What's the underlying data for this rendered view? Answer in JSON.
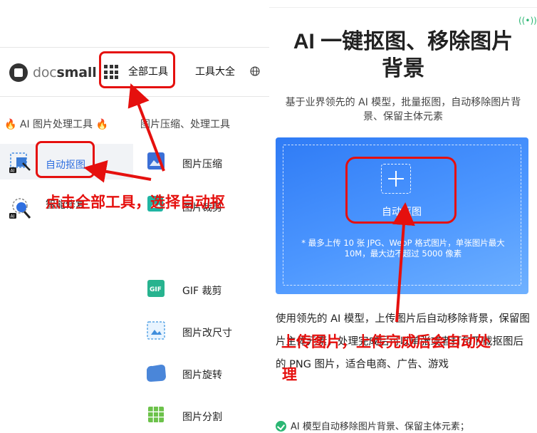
{
  "site": {
    "logo_prefix": "doc",
    "logo_suffix": "small",
    "nav": {
      "all_tools": "全部工具",
      "tools_collection": "工具大全"
    }
  },
  "menu": {
    "category_ai": "🔥 AI 图片处理工具 🔥",
    "category_image": "图片压缩、处理工具",
    "ai_items": [
      {
        "label": "自动抠图",
        "icon": "auto-matting-icon",
        "selected": true
      },
      {
        "label": "智能修复",
        "icon": "smart-repair-icon",
        "selected": false
      }
    ],
    "image_items": [
      {
        "label": "图片压缩",
        "icon": "image-compress-icon"
      },
      {
        "label": "图片裁剪",
        "icon": "image-crop-icon"
      },
      {
        "label": "GIF 裁剪",
        "icon": "gif-crop-icon"
      },
      {
        "label": "图片改尺寸",
        "icon": "image-resize-icon"
      },
      {
        "label": "图片旋转",
        "icon": "image-rotate-icon"
      },
      {
        "label": "图片分割",
        "icon": "image-split-icon"
      }
    ]
  },
  "hero": {
    "title_line1": "AI 一键抠图、移除图片",
    "title_line2": "背景",
    "subtitle": "基于业界领先的 AI 模型，批量抠图，自动移除图片背景、保留主体元素"
  },
  "upload": {
    "label": "自动抠图",
    "note": "* 最多上传 10 张 JPG、WebP 格式图片，单张图片最大 10M，最大边不超过 5000 像素"
  },
  "description": "使用领先的 AI 模型，上传图片后自动移除背景，保留图片主体元素，处理完成后可以单张或者打包下载抠图后的 PNG 图片，适合电商、广告、游戏",
  "features": [
    "AI 模型自动移除图片背景、保留主体元素；"
  ],
  "annotations": {
    "left_instruction": "点击全部工具，选择自动抠",
    "right_instruction_line1": "上传图片，上传完成后会自动处",
    "right_instruction_line2": "理"
  },
  "colors": {
    "accent": "#2f7bf5",
    "annotation": "#e5100e",
    "success": "#2bb673"
  }
}
